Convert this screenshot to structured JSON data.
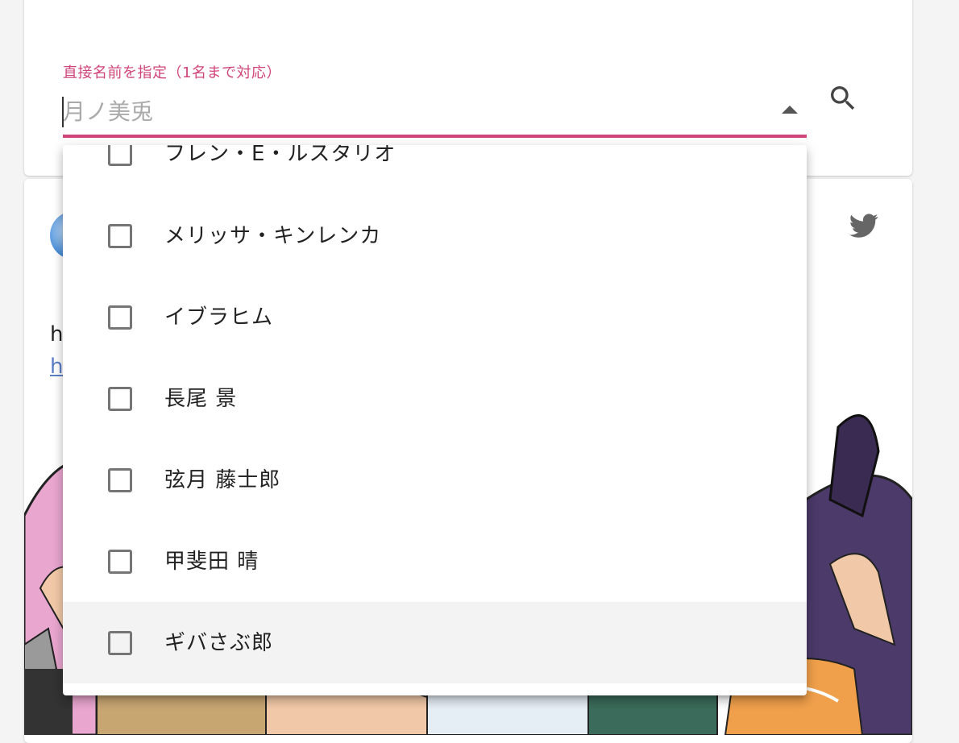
{
  "search": {
    "label": "直接名前を指定（1名まで対応）",
    "placeholder": "月ノ美兎",
    "accent_color": "#d0457a"
  },
  "tweet": {
    "text": "h",
    "link": "ht"
  },
  "dropdown": {
    "items": [
      {
        "label": "フレン・E・ルスタリオ",
        "checked": false
      },
      {
        "label": "メリッサ・キンレンカ",
        "checked": false
      },
      {
        "label": "イブラヒム",
        "checked": false
      },
      {
        "label": "長尾 景",
        "checked": false
      },
      {
        "label": "弦月 藤士郎",
        "checked": false
      },
      {
        "label": "甲斐田 晴",
        "checked": false
      },
      {
        "label": "ギバさぶ郎",
        "checked": false
      }
    ]
  },
  "icons": {
    "search": "search-icon",
    "dropdown": "arrow-drop-up-icon",
    "twitter": "twitter-icon"
  }
}
